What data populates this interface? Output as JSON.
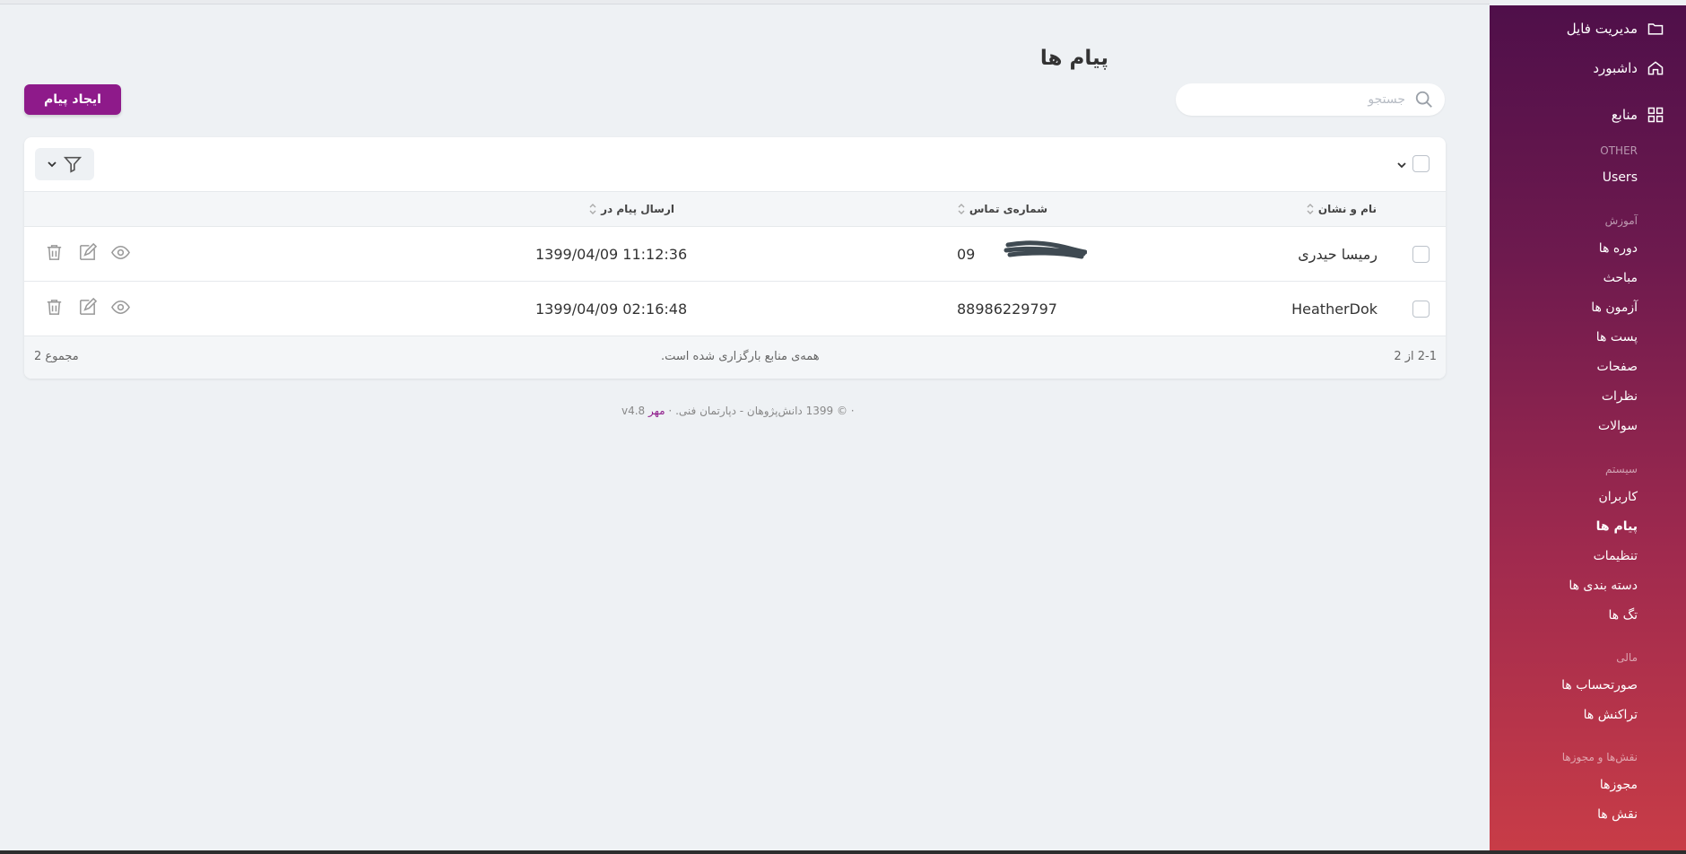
{
  "sidebar": {
    "file_manager": "مدیریت فایل",
    "dashboard": "داشبورد",
    "resources": "منابع",
    "other_heading": "OTHER",
    "users_en": "Users",
    "education_heading": "آموزش",
    "courses": "دوره ها",
    "topics": "مباحث",
    "exams": "آزمون ها",
    "posts": "پست ها",
    "pages": "صفحات",
    "comments": "نظرات",
    "questions": "سوالات",
    "system_heading": "سیستم",
    "users": "کاربران",
    "messages": "پیام ها",
    "settings": "تنظیمات",
    "categories": "دسته بندی ها",
    "tags": "تگ ها",
    "finance_heading": "مالی",
    "invoices": "صورتحساب ها",
    "transactions": "تراکنش ها",
    "roles_heading": "نقش‌ها و مجوزها",
    "permissions": "مجوزها",
    "roles": "نقش ها"
  },
  "header": {
    "title": "پیام ها",
    "search_placeholder": "جستجو",
    "create_button": "ایجاد پیام"
  },
  "table": {
    "columns": {
      "name": "نام و نشان",
      "phone": "شماره‌ی تماس",
      "sent_at": "ارسال پیام در"
    },
    "rows": [
      {
        "name": "رمیسا حیدری",
        "phone": "09",
        "sent_at": "1399/04/09 11:12:36"
      },
      {
        "name": "HeatherDok",
        "phone": "88986229797",
        "sent_at": "1399/04/09 02:16:48"
      }
    ],
    "pagination": "2-1 از 2",
    "loaded_status": "همه‌ی منابع بارگزاری شده است.",
    "total": "مجموع 2"
  },
  "footer": {
    "copyright": "© 1399 دانش‌پژوهان - دپارتمان فنی.",
    "brand": "مهر",
    "version": "v4.8"
  },
  "colors": {
    "accent": "#8e1a8a",
    "sidebar_top": "#4f0f4a",
    "sidebar_bottom": "#c83c47"
  }
}
